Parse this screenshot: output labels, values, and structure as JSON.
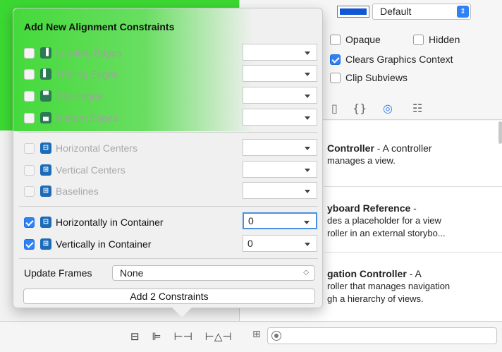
{
  "popover": {
    "title": "Add New Alignment Constraints",
    "constraints": [
      {
        "label": "Leading Edges",
        "checked": false,
        "value": "",
        "icon": "leading-edges-icon"
      },
      {
        "label": "Trailing Edges",
        "checked": false,
        "value": "",
        "icon": "trailing-edges-icon"
      },
      {
        "label": "Top Edges",
        "checked": false,
        "value": "",
        "icon": "top-edges-icon"
      },
      {
        "label": "Bottom Edges",
        "checked": false,
        "value": "",
        "icon": "bottom-edges-icon"
      },
      {
        "label": "Horizontal Centers",
        "checked": false,
        "value": "",
        "icon": "horizontal-centers-icon"
      },
      {
        "label": "Vertical Centers",
        "checked": false,
        "value": "",
        "icon": "vertical-centers-icon"
      },
      {
        "label": "Baselines",
        "checked": false,
        "value": "",
        "icon": "baselines-icon"
      },
      {
        "label": "Horizontally in Container",
        "checked": true,
        "value": "0",
        "icon": "horizontally-in-container-icon"
      },
      {
        "label": "Vertically in Container",
        "checked": true,
        "value": "0",
        "icon": "vertically-in-container-icon"
      }
    ],
    "update_frames_label": "Update Frames",
    "update_frames_value": "None",
    "add_button_label": "Add 2 Constraints"
  },
  "inspector": {
    "background_value": "Default",
    "background_color": "#1057d6",
    "opaque_label": "Opaque",
    "hidden_label": "Hidden",
    "clears_graphics_label": "Clears Graphics Context",
    "clip_subviews_label": "Clip Subviews",
    "clears_graphics_checked": true
  },
  "library": {
    "tabs": [
      "{}",
      "◎",
      "☷"
    ],
    "items": [
      {
        "title": "Controller",
        "title_suffix": " - A controller",
        "line2": "manages a view."
      },
      {
        "title": "yboard Reference",
        "title_suffix": " -",
        "line2": "des a placeholder for a view",
        "line3": "roller in an external storybo..."
      },
      {
        "title": "gation Controller",
        "title_suffix": " - A",
        "line2": "roller that manages navigation",
        "line3": "gh a hierarchy of views."
      }
    ]
  },
  "toolbar": {
    "icons": [
      "stack-icon",
      "align-icon",
      "pin-icon",
      "resolve-issues-icon"
    ]
  },
  "colors": {
    "canvas_green": "#3cd832",
    "accent": "#2f82f5"
  }
}
